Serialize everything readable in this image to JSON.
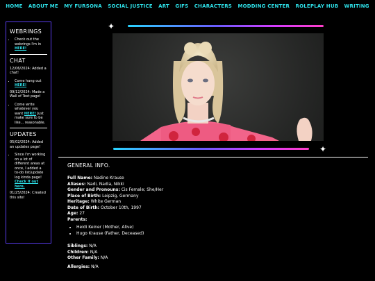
{
  "nav": [
    "HOME",
    "ABOUT ME",
    "MY FURSONA",
    "SOCIAL JUSTICE",
    "ART",
    "GIFS",
    "CHARACTERS",
    "MODDING CENTER",
    "ROLEPLAY HUB",
    "WRITING"
  ],
  "sidebar": {
    "webrings": {
      "title": "WEBRINGS",
      "item_text": "Check out the webrings I'm in",
      "item_link": "HERE!"
    },
    "chat": {
      "title": "CHAT",
      "entry1": "12/06/2024: Added a chat!",
      "bullet1_text": "Come hang out",
      "bullet1_link": "HERE!",
      "entry2": "09/12/2024: Made a Wall of Text page!",
      "bullet2_text": "Come write whatever you want",
      "bullet2_link": "HERE!",
      "bullet2_tail": "Just make sure to be like... reasonable."
    },
    "updates": {
      "title": "UPDATES",
      "entry1": "05/02/2024: Added an updates page!",
      "bullet_text": "Since I'm working on a lot of different areas at once, I added a to-do list/update log kinda page!",
      "bullet_link": "Check it out here.",
      "entry2": "01/25/2024: Created this site!"
    }
  },
  "info": {
    "title": "GENERAL INFO.",
    "full_name_label": "Full Name:",
    "full_name": "Nadine Krause",
    "aliases_label": "Aliases:",
    "aliases": "Nadi, Nadia, Nikki",
    "gender_label": "Gender and Pronouns:",
    "gender": "Cis Female; She/Her",
    "birthplace_label": "Place of Birth:",
    "birthplace": "Leipzig, Germany",
    "heritage_label": "Heritage:",
    "heritage": "White German",
    "dob_label": "Date of Birth:",
    "dob": "October 10th, 1997",
    "age_label": "Age:",
    "age": "27",
    "parents_label": "Parents:",
    "parents": [
      "Heidi Keiner (Mother, Alive)",
      "Hugo Krause (Father, Deceased)"
    ],
    "siblings_label": "Siblings:",
    "siblings": "N/A",
    "children_label": "Children:",
    "children": "N/A",
    "other_family_label": "Other Family:",
    "other_family": "N/A",
    "allergies_label": "Allergies:",
    "allergies": "N/A"
  },
  "colors": {
    "nav": "#2ee0e8",
    "sidebar_border": "#5a3df0",
    "gradient": [
      "#2ad4ff",
      "#6a5cff",
      "#d63cff",
      "#ff3ec8"
    ]
  },
  "icons": {
    "sparkle": "✦"
  }
}
